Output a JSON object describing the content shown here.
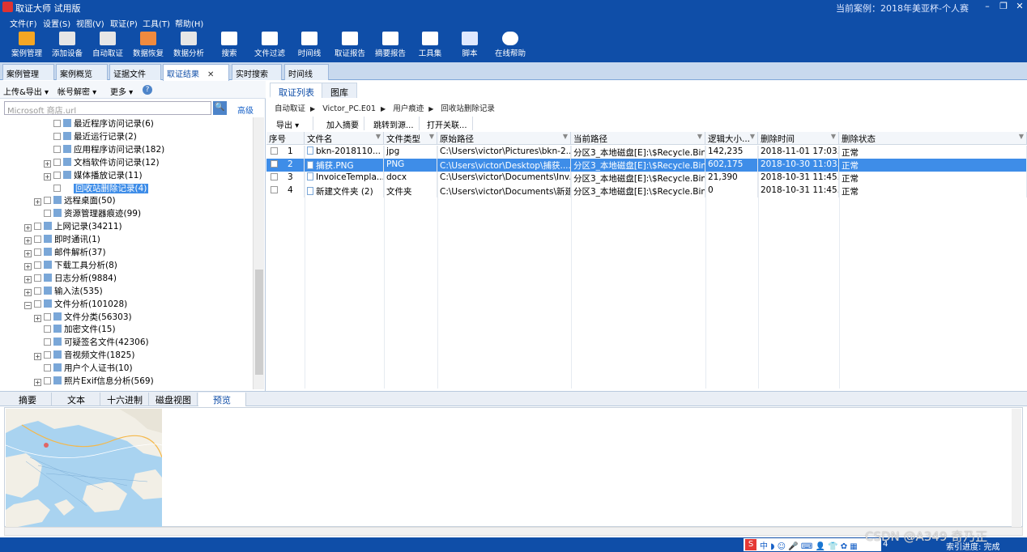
{
  "window": {
    "title": "取证大师 试用版",
    "case_label": "当前案例：2018年美亚杯-个人赛",
    "minimize": "–",
    "maximize": "❐",
    "close": "✕"
  },
  "menu": [
    "文件(F)",
    "设置(S)",
    "视图(V)",
    "取证(P)",
    "工具(T)",
    "帮助(H)"
  ],
  "toolbar": [
    {
      "label": "案例管理",
      "icon": "case-manage-icon",
      "color": "#f5a623"
    },
    {
      "label": "添加设备",
      "icon": "add-device-icon",
      "color": "#e6e6e6"
    },
    {
      "label": "自动取证",
      "icon": "auto-forensic-icon",
      "color": "#e6e6e6"
    },
    {
      "label": "数据恢复",
      "icon": "data-recovery-icon",
      "color": "#f08a3e"
    },
    {
      "label": "数据分析",
      "icon": "data-analysis-icon",
      "color": "#e6e6e6"
    },
    {
      "label": "搜索",
      "icon": "search-doc-icon",
      "color": "#ffffff"
    },
    {
      "label": "文件过滤",
      "icon": "file-filter-icon",
      "color": "#ffffff"
    },
    {
      "label": "时间线",
      "icon": "timeline-icon",
      "color": "#ffffff"
    },
    {
      "label": "取证报告",
      "icon": "report-icon",
      "color": "#ffffff"
    },
    {
      "label": "摘要报告",
      "icon": "summary-report-icon",
      "color": "#ffffff"
    },
    {
      "label": "工具集",
      "icon": "toolset-icon",
      "color": "#ffffff"
    },
    {
      "label": "脚本",
      "icon": "script-icon",
      "color": "#dfe8ff"
    },
    {
      "label": "在线帮助",
      "icon": "online-help-icon",
      "color": "#ffffff"
    }
  ],
  "doc_tabs": [
    {
      "label": "案例管理"
    },
    {
      "label": "案例概览"
    },
    {
      "label": "证据文件"
    },
    {
      "label": "取证结果",
      "active": true,
      "close": "✕"
    },
    {
      "label": "实时搜索"
    },
    {
      "label": "时间线"
    }
  ],
  "left": {
    "actions": [
      "上传&导出 ▾",
      "帐号解密 ▾",
      "更多 ▾",
      "?"
    ],
    "search_placeholder": "Microsoft 商店.url",
    "search_button": "🔍",
    "advanced": "高级",
    "tree": [
      {
        "label": "最近程序访问记录(6)",
        "level": 3,
        "icon": "doc-icon"
      },
      {
        "label": "最近运行记录(2)",
        "level": 3,
        "icon": "doc-icon"
      },
      {
        "label": "应用程序访问记录(182)",
        "level": 3,
        "icon": "doc-icon"
      },
      {
        "label": "文档软件访问记录(12)",
        "level": 3,
        "icon": "doc-icon",
        "expand": "+"
      },
      {
        "label": "媒体播放记录(11)",
        "level": 3,
        "icon": "doc-icon",
        "expand": "+"
      },
      {
        "label": "回收站删除记录(4)",
        "level": 3,
        "icon": "recycle-bin-icon",
        "selected": true
      },
      {
        "label": "远程桌面(50)",
        "level": 2,
        "icon": "remote-desktop-icon",
        "expand": "+"
      },
      {
        "label": "资源管理器痕迹(99)",
        "level": 2,
        "icon": "folder-icon"
      },
      {
        "label": "上网记录(34211)",
        "level": 1,
        "icon": "globe-icon",
        "expand": "+"
      },
      {
        "label": "即时通讯(1)",
        "level": 1,
        "icon": "chat-icon",
        "expand": "+"
      },
      {
        "label": "邮件解析(37)",
        "level": 1,
        "icon": "mail-icon",
        "expand": "+"
      },
      {
        "label": "下载工具分析(8)",
        "level": 1,
        "icon": "download-icon",
        "expand": "+"
      },
      {
        "label": "日志分析(9884)",
        "level": 1,
        "icon": "log-icon",
        "expand": "+"
      },
      {
        "label": "输入法(535)",
        "level": 1,
        "icon": "input-method-icon",
        "expand": "+"
      },
      {
        "label": "文件分析(101028)",
        "level": 1,
        "icon": "file-analysis-icon",
        "expand": "−"
      },
      {
        "label": "文件分类(56303)",
        "level": 2,
        "icon": "file-class-icon",
        "expand": "+"
      },
      {
        "label": "加密文件(15)",
        "level": 2,
        "icon": "lock-icon"
      },
      {
        "label": "可疑签名文件(42306)",
        "level": 2,
        "icon": "question-icon"
      },
      {
        "label": "音视频文件(1825)",
        "level": 2,
        "icon": "media-icon",
        "expand": "+"
      },
      {
        "label": "用户个人证书(10)",
        "level": 2,
        "icon": "certificate-icon"
      },
      {
        "label": "照片Exif信息分析(569)",
        "level": 2,
        "icon": "photo-icon",
        "expand": "+"
      }
    ]
  },
  "right": {
    "tabs": [
      {
        "label": "取证列表",
        "active": true
      },
      {
        "label": "图库"
      }
    ],
    "breadcrumb": [
      "自动取证",
      "Victor_PC.E01",
      "用户痕迹",
      "回收站删除记录"
    ],
    "actions": [
      "导出  ▾",
      "加入摘要",
      "跳转到源...",
      "打开关联..."
    ],
    "columns": [
      "序号",
      "文件名",
      "文件类型",
      "原始路径",
      "当前路径",
      "逻辑大小...",
      "删除时间",
      "删除状态"
    ],
    "rows": [
      {
        "no": "1",
        "name": "bkn-2018110...",
        "type": "jpg",
        "orig": "C:\\Users\\victor\\Pictures\\bkn-2...",
        "cur": "分区3_本地磁盘[E]:\\$Recycle.Bin\\...",
        "size": "142,235",
        "time": "2018-11-01 17:03...",
        "status": "正常"
      },
      {
        "no": "2",
        "name": "捕获.PNG",
        "type": "PNG",
        "orig": "C:\\Users\\victor\\Desktop\\捕获....",
        "cur": "分区3_本地磁盘[E]:\\$Recycle.Bin\\...",
        "size": "602,175",
        "time": "2018-10-30 11:03...",
        "status": "正常",
        "selected": true
      },
      {
        "no": "3",
        "name": "InvoiceTempla...",
        "type": "docx",
        "orig": "C:\\Users\\victor\\Documents\\Inv...",
        "cur": "分区3_本地磁盘[E]:\\$Recycle.Bin...",
        "size": "21,390",
        "time": "2018-10-31 11:45...",
        "status": "正常"
      },
      {
        "no": "4",
        "name": "新建文件夹 (2)",
        "type": "文件夹",
        "orig": "C:\\Users\\victor\\Documents\\新建...",
        "cur": "分区3_本地磁盘[E]:\\$Recycle.Bin\\...",
        "size": "0",
        "time": "2018-10-31 11:45...",
        "status": "正常"
      }
    ]
  },
  "bottom": {
    "tabs": [
      {
        "label": "摘要"
      },
      {
        "label": "文本"
      },
      {
        "label": "十六进制"
      },
      {
        "label": "磁盘视图"
      },
      {
        "label": "预览",
        "active": true
      }
    ]
  },
  "status": {
    "left_label": "索引进度: 完成",
    "count": "4",
    "ime": "中 ◗ ☺ 🎤 ⌨ 👤 👕 ✿ ▦",
    "watermark": "CSDN @A349 奇乃正"
  }
}
